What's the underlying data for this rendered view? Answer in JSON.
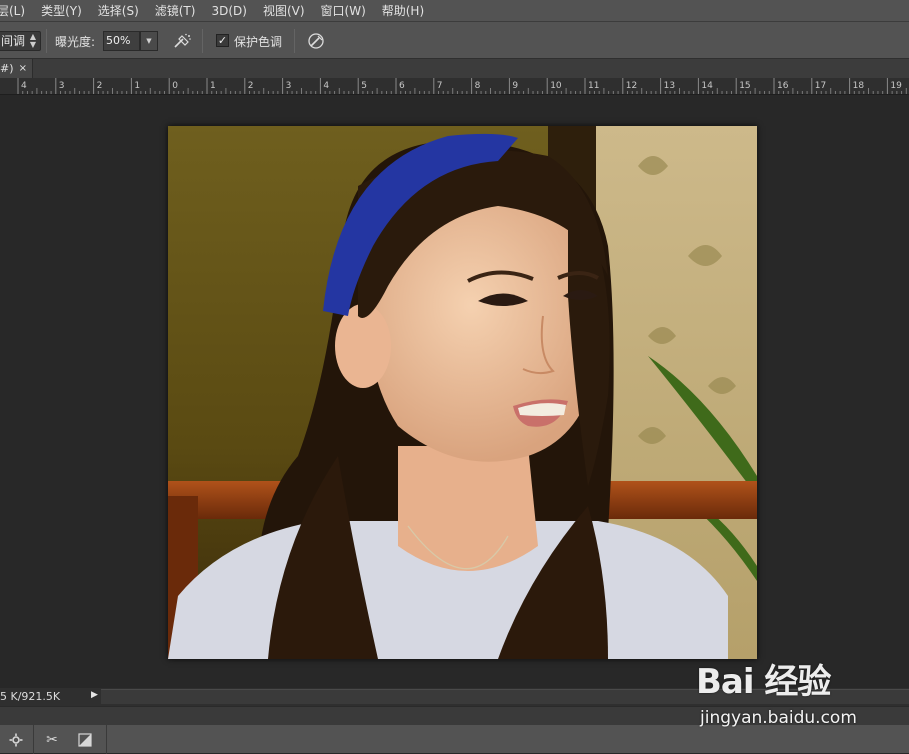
{
  "menu": {
    "items": [
      {
        "label": "层(L)"
      },
      {
        "label": "类型(Y)"
      },
      {
        "label": "选择(S)"
      },
      {
        "label": "滤镜(T)"
      },
      {
        "label": "3D(D)"
      },
      {
        "label": "视图(V)"
      },
      {
        "label": "窗口(W)"
      },
      {
        "label": "帮助(H)"
      }
    ]
  },
  "options": {
    "range_value": "间调",
    "exposure_label": "曝光度:",
    "exposure_value": "50%",
    "protect_checked": "✓",
    "protect_label": "保护色调"
  },
  "tab": {
    "title": "#)",
    "close": "×"
  },
  "ruler": {
    "labels": [
      "4",
      "3",
      "2",
      "1",
      "0",
      "1",
      "2",
      "3",
      "4",
      "5",
      "6",
      "7",
      "8",
      "9",
      "10",
      "11",
      "12",
      "13",
      "14",
      "15",
      "16",
      "17",
      "18",
      "19"
    ]
  },
  "status": {
    "doc_size": "5 K/921.5K",
    "arrow": "▶"
  },
  "watermark": {
    "logo": "Bai 经验",
    "url": "jingyan.baidu.com"
  },
  "icons": {
    "settings": "gear-icon",
    "scissors": "scissors-icon",
    "mask": "quick-mask-icon",
    "airbrush": "airbrush-icon",
    "pressure": "pressure-icon"
  }
}
